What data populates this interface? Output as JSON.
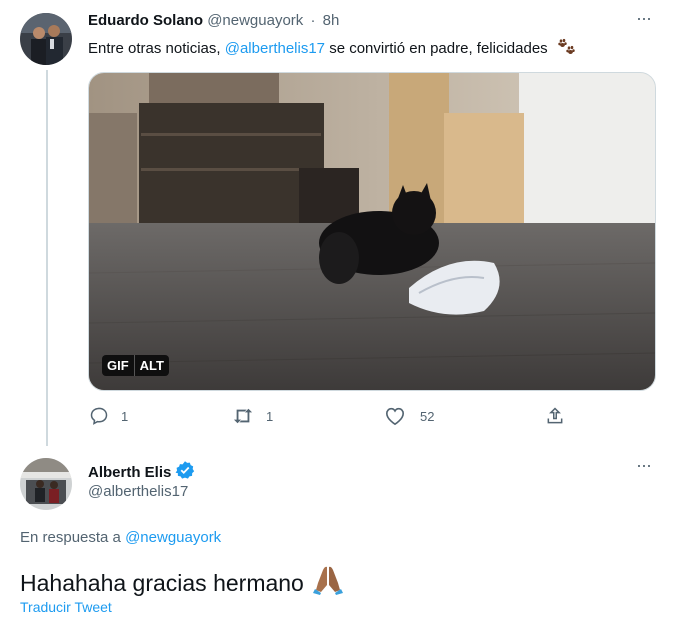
{
  "tweet1": {
    "author_name": "Eduardo Solano",
    "author_handle": "@newguayork",
    "separator": "·",
    "time": "8h",
    "text_before": "Entre otras noticias, ",
    "mention": "@alberthelis17",
    "text_after": " se convirtió en padre, felicidades",
    "emoji": "paw-prints",
    "media": {
      "gif_label": "GIF",
      "alt_label": "ALT"
    },
    "actions": {
      "reply_count": "1",
      "retweet_count": "1",
      "like_count": "52"
    },
    "more_label": "···"
  },
  "tweet2": {
    "author_name": "Alberth Elis",
    "author_handle": "@alberthelis17",
    "verified": true,
    "reply_prefix": "En respuesta a",
    "reply_mention": "@newguayork",
    "text": "Hahahaha gracias hermano",
    "emoji": "folded-hands",
    "translate_label": "Traducir Tweet",
    "more_label": "···"
  },
  "colors": {
    "link": "#1d9bf0",
    "secondary": "#536471",
    "primary_text": "#0f1419",
    "border": "#cfd9de"
  }
}
